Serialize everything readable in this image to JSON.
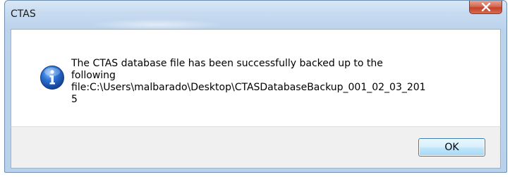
{
  "window": {
    "title": "CTAS"
  },
  "dialog": {
    "message_line1": "The CTAS database file has been successfully backed up to the",
    "message_line2": "following",
    "message_line3": "file:C:\\Users\\malbarado\\Desktop\\CTASDatabaseBackup_001_02_03_201",
    "message_line4": "5",
    "icon": "info-icon"
  },
  "buttons": {
    "ok_label": "OK",
    "close_icon": "close-icon"
  },
  "colors": {
    "accent": "#3c7fb1",
    "close": "#c2432b",
    "info": "#1f5fbf"
  }
}
